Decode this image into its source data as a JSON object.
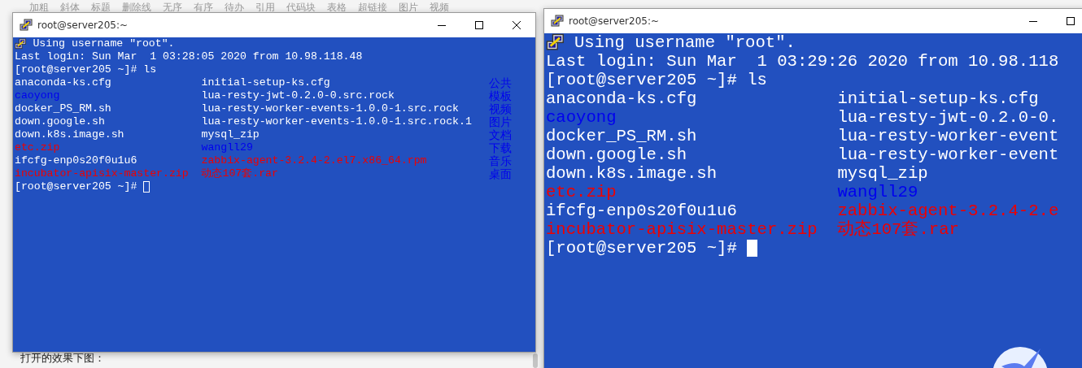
{
  "toolbar": [
    "加粗",
    "斜体",
    "标题",
    "删除线",
    "无序",
    "有序",
    "待办",
    "引用",
    "代码块",
    "表格",
    "超链接",
    "图片",
    "视频"
  ],
  "windows": [
    {
      "title": "root@server205:~",
      "focused": false,
      "closable": true,
      "intro": "Using username \"root\".",
      "lines": [
        "Last login: Sun Mar  1 03:28:05 2020 from 10.98.118.48",
        "[root@server205 ~]# ls"
      ],
      "files": [
        {
          "name": "anaconda-ks.cfg",
          "color": "#ffffff"
        },
        {
          "name": "initial-setup-ks.cfg",
          "color": "#ffffff"
        },
        {
          "name": "caoyong",
          "color": "#0000ee"
        },
        {
          "name": "lua-resty-jwt-0.2.0-0.src.rock",
          "color": "#ffffff"
        },
        {
          "name": "docker_PS_RM.sh",
          "color": "#ffffff"
        },
        {
          "name": "lua-resty-worker-events-1.0.0-1.src.rock",
          "color": "#ffffff"
        },
        {
          "name": "down.google.sh",
          "color": "#ffffff"
        },
        {
          "name": "lua-resty-worker-events-1.0.0-1.src.rock.1",
          "color": "#ffffff"
        },
        {
          "name": "down.k8s.image.sh",
          "color": "#ffffff"
        },
        {
          "name": "mysql_zip",
          "color": "#ffffff"
        },
        {
          "name": "etc.zip",
          "color": "#ee0000"
        },
        {
          "name": "wangll29",
          "color": "#0000ee"
        },
        {
          "name": "ifcfg-enp0s20f0u1u6",
          "color": "#ffffff"
        },
        {
          "name": "zabbix-agent-3.2.4-2.el7.x86_64.rpm",
          "color": "#ee0000"
        },
        {
          "name": "incubator-apisix-master.zip",
          "color": "#ee0000"
        },
        {
          "name": "动态107套.rar",
          "color": "#ee0000"
        }
      ],
      "side_labels": [
        "公共",
        "模板",
        "视频",
        "图片",
        "文档",
        "下载",
        "音乐",
        "桌面"
      ],
      "prompt": "[root@server205 ~]#"
    },
    {
      "title": "root@server205:~",
      "focused": true,
      "closable": false,
      "intro": "Using username \"root\".",
      "lines": [
        "Last login: Sun Mar  1 03:29:26 2020 from 10.98.118",
        "[root@server205 ~]# ls"
      ],
      "files": [
        {
          "name": "anaconda-ks.cfg",
          "color": "#ffffff"
        },
        {
          "name": "initial-setup-ks.cfg",
          "color": "#ffffff"
        },
        {
          "name": "caoyong",
          "color": "#0000ee"
        },
        {
          "name": "lua-resty-jwt-0.2.0-0.",
          "color": "#ffffff"
        },
        {
          "name": "docker_PS_RM.sh",
          "color": "#ffffff"
        },
        {
          "name": "lua-resty-worker-event",
          "color": "#ffffff"
        },
        {
          "name": "down.google.sh",
          "color": "#ffffff"
        },
        {
          "name": "lua-resty-worker-event",
          "color": "#ffffff"
        },
        {
          "name": "down.k8s.image.sh",
          "color": "#ffffff"
        },
        {
          "name": "mysql_zip",
          "color": "#ffffff"
        },
        {
          "name": "etc.zip",
          "color": "#ee0000"
        },
        {
          "name": "wangll29",
          "color": "#0000ee"
        },
        {
          "name": "ifcfg-enp0s20f0u1u6",
          "color": "#ffffff"
        },
        {
          "name": "zabbix-agent-3.2.4-2.e",
          "color": "#ee0000"
        },
        {
          "name": "incubator-apisix-master.zip",
          "color": "#ee0000"
        },
        {
          "name": "动态107套.rar",
          "color": "#ee0000"
        }
      ],
      "prompt": "[root@server205 ~]#"
    }
  ],
  "caption": "打开的效果下图："
}
